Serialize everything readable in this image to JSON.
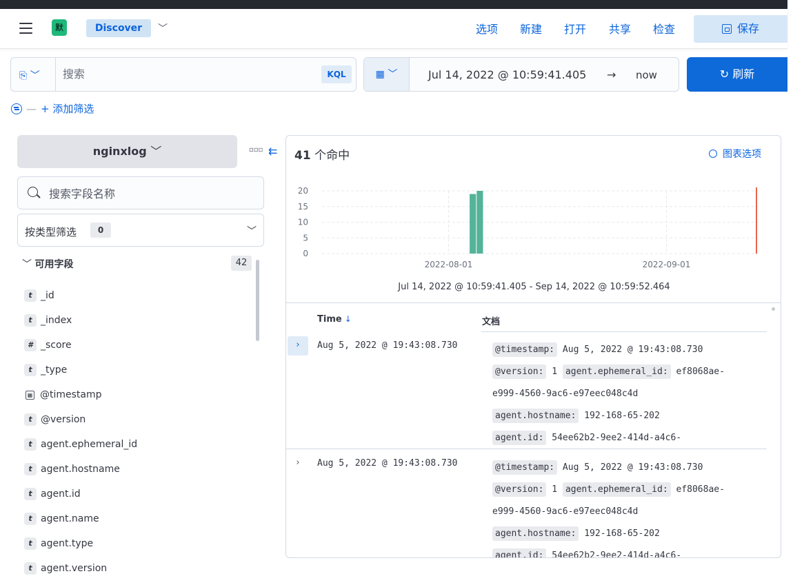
{
  "header": {
    "space_initial": "默",
    "app_name": "Discover",
    "menu": [
      "选项",
      "新建",
      "打开",
      "共享",
      "检查"
    ],
    "save_label": "保存"
  },
  "query": {
    "placeholder": "搜索",
    "language": "KQL"
  },
  "time": {
    "start": "Jul 14, 2022 @ 10:59:41.405",
    "arrow": "→",
    "end": "now",
    "refresh_label": "刷新"
  },
  "filters": {
    "add_label": "+ 添加筛选"
  },
  "sidebar": {
    "index_pattern": "nginxlog",
    "field_search_placeholder": "搜索字段名称",
    "type_filter_label": "按类型筛选",
    "type_filter_count": "0",
    "available_fields_label": "可用字段",
    "available_fields_count": "42",
    "fields": [
      {
        "type": "t",
        "name": "_id"
      },
      {
        "type": "t",
        "name": "_index"
      },
      {
        "type": "#",
        "name": "_score"
      },
      {
        "type": "t",
        "name": "_type"
      },
      {
        "type": "date",
        "name": "@timestamp"
      },
      {
        "type": "t",
        "name": "@version"
      },
      {
        "type": "t",
        "name": "agent.ephemeral_id"
      },
      {
        "type": "t",
        "name": "agent.hostname"
      },
      {
        "type": "t",
        "name": "agent.id"
      },
      {
        "type": "t",
        "name": "agent.name"
      },
      {
        "type": "t",
        "name": "agent.type"
      },
      {
        "type": "t",
        "name": "agent.version"
      }
    ]
  },
  "results": {
    "hits_count": "41",
    "hits_label": "个命中",
    "chart_options_label": "图表选项",
    "range_label": "Jul 14, 2022 @ 10:59:41.405 - Sep 14, 2022 @ 10:59:52.464",
    "columns": {
      "time": "Time",
      "sort_icon": "↓",
      "doc": "文档"
    },
    "rows": [
      {
        "time": "Aug 5, 2022 @ 19:43:08.730",
        "timestamp_key": "@timestamp:",
        "timestamp_val": "Aug 5, 2022 @ 19:43:08.730",
        "version_key": "@version:",
        "version_val": "1",
        "eph_key": "agent.ephemeral_id:",
        "eph_val_a": "ef8068ae-",
        "eph_val_b": "e999-4560-9ac6-e97eec048c4d",
        "host_key": "agent.hostname:",
        "host_val": "192-168-65-202",
        "id_key": "agent.id:",
        "id_val": "54ee62b2-9ee2-414d-a4c6-"
      },
      {
        "time": "Aug 5, 2022 @ 19:43:08.730",
        "timestamp_key": "@timestamp:",
        "timestamp_val": "Aug 5, 2022 @ 19:43:08.730",
        "version_key": "@version:",
        "version_val": "1",
        "eph_key": "agent.ephemeral_id:",
        "eph_val_a": "ef8068ae-",
        "eph_val_b": "e999-4560-9ac6-e97eec048c4d",
        "host_key": "agent.hostname:",
        "host_val": "192-168-65-202",
        "id_key": "agent.id:",
        "id_val": "54ee62b2-9ee2-414d-a4c6-"
      }
    ]
  },
  "chart_data": {
    "type": "bar",
    "y_ticks": [
      "20",
      "15",
      "10",
      "5",
      "0"
    ],
    "x_ticks": [
      "2022-08-01",
      "2022-09-01"
    ],
    "ylim": [
      0,
      20
    ],
    "xlim": [
      "2022-07-14",
      "2022-09-14"
    ],
    "bars": [
      {
        "x": "2022-08-04",
        "value": 19
      },
      {
        "x": "2022-08-05",
        "value": 20
      }
    ],
    "now_marker": "2022-09-14",
    "bar_color": "#54b399",
    "marker_color": "#e7664c"
  }
}
